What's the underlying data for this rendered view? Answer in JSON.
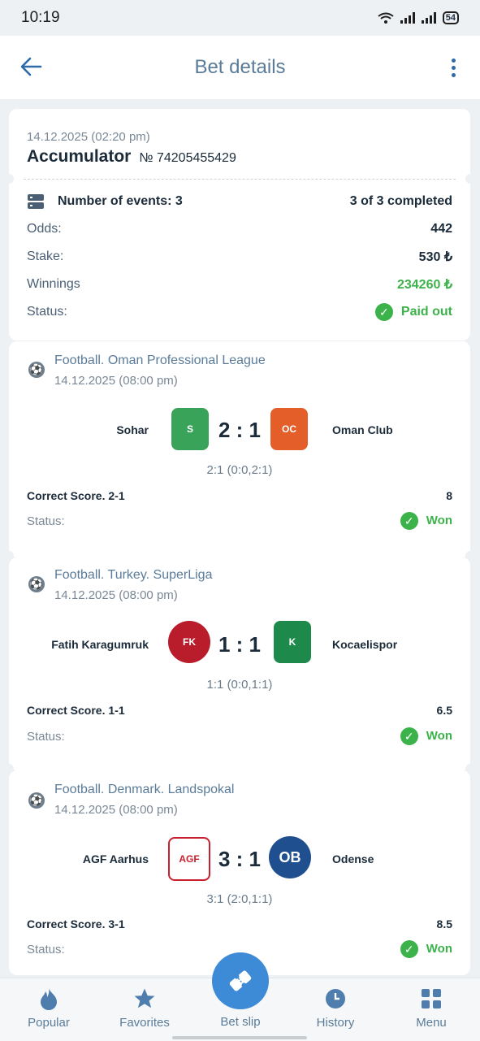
{
  "status_bar": {
    "time": "10:19",
    "battery": "54"
  },
  "header": {
    "title": "Bet details"
  },
  "bet": {
    "date": "14.12.2025 (02:20 pm)",
    "type": "Accumulator",
    "number": "№ 74205455429",
    "events_label": "Number of events: 3",
    "events_completed": "3 of 3 completed",
    "odds_label": "Odds:",
    "odds_value": "442",
    "stake_label": "Stake:",
    "stake_value": "530 ₺",
    "winnings_label": "Winnings",
    "winnings_value": "234260 ₺",
    "status_label": "Status:",
    "status_value": "Paid out"
  },
  "events": [
    {
      "league": "Football. Oman Professional League",
      "date": "14.12.2025 (08:00 pm)",
      "home": "Sohar",
      "away": "Oman Club",
      "score": "2 : 1",
      "detail": "2:1 (0:0,2:1)",
      "market": "Correct Score. 2-1",
      "odds": "8",
      "status_label": "Status:",
      "status": "Won"
    },
    {
      "league": "Football. Turkey. SuperLiga",
      "date": "14.12.2025 (08:00 pm)",
      "home": "Fatih Karagumruk",
      "away": "Kocaelispor",
      "score": "1 : 1",
      "detail": "1:1 (0:0,1:1)",
      "market": "Correct Score. 1-1",
      "odds": "6.5",
      "status_label": "Status:",
      "status": "Won"
    },
    {
      "league": "Football. Denmark. Landspokal",
      "date": "14.12.2025 (08:00 pm)",
      "home": "AGF Aarhus",
      "away": "Odense",
      "score": "3 : 1",
      "detail": "3:1 (2:0,1:1)",
      "market": "Correct Score. 3-1",
      "odds": "8.5",
      "status_label": "Status:",
      "status": "Won"
    }
  ],
  "nav": {
    "popular": "Popular",
    "favorites": "Favorites",
    "betslip": "Bet slip",
    "history": "History",
    "menu": "Menu"
  },
  "colors": {
    "accent": "#3d8ad6",
    "won": "#3cb34a",
    "title": "#5a7c99"
  }
}
